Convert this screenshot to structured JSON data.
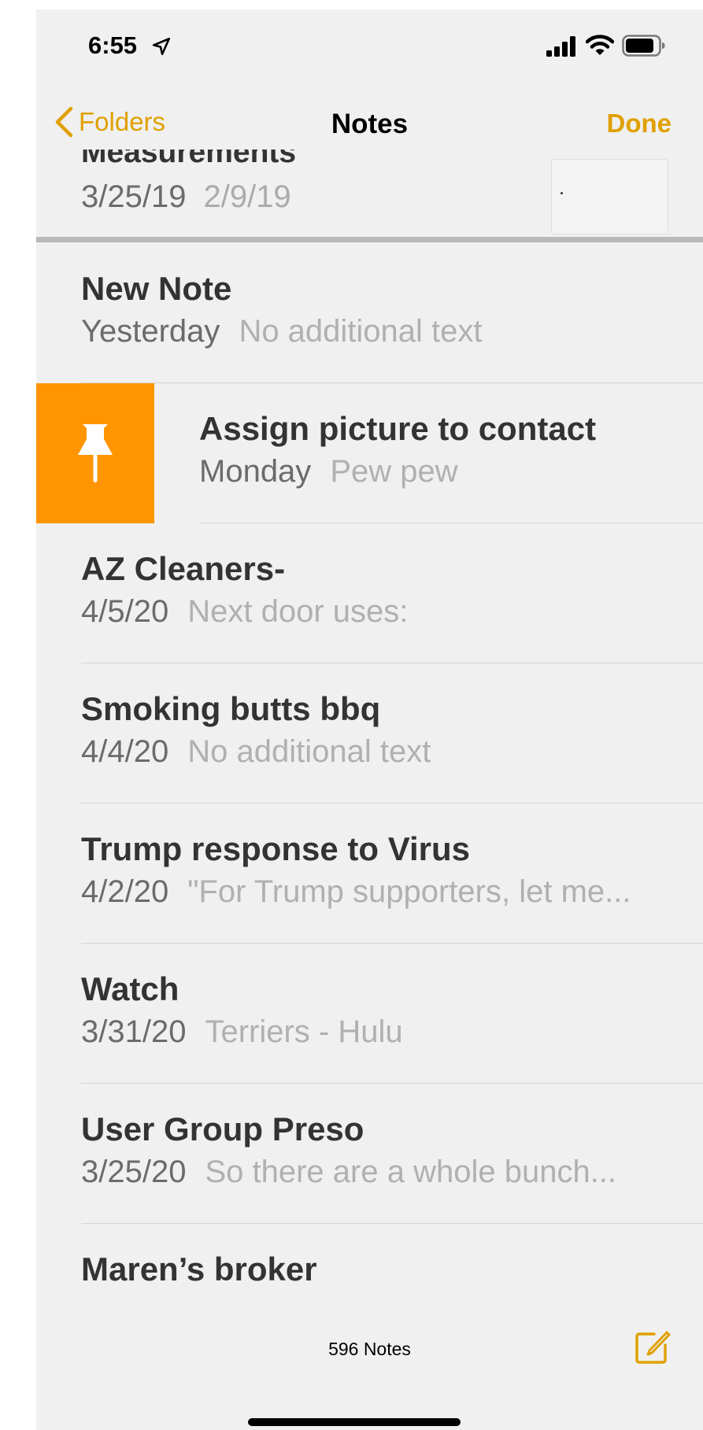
{
  "status_bar": {
    "time": "6:55"
  },
  "nav": {
    "back_label": "Folders",
    "title": "Notes",
    "done_label": "Done"
  },
  "partial_note": {
    "title": "Measurements",
    "date": "3/25/19",
    "preview": "2/9/19"
  },
  "notes": [
    {
      "title": "New Note",
      "date": "Yesterday",
      "preview": "No additional text",
      "pinned_swipe": false
    },
    {
      "title": "Assign picture to contact",
      "date": "Monday",
      "preview": "Pew pew",
      "pinned_swipe": true
    },
    {
      "title": "AZ Cleaners-",
      "date": "4/5/20",
      "preview": "Next door uses:",
      "pinned_swipe": false
    },
    {
      "title": "Smoking butts bbq",
      "date": "4/4/20",
      "preview": "No additional text",
      "pinned_swipe": false
    },
    {
      "title": "Trump response to Virus",
      "date": "4/2/20",
      "preview": "\"For Trump supporters, let me...",
      "pinned_swipe": false
    },
    {
      "title": "Watch",
      "date": "3/31/20",
      "preview": "Terriers - Hulu",
      "pinned_swipe": false
    },
    {
      "title": "User Group Preso",
      "date": "3/25/20",
      "preview": "So there are a whole bunch...",
      "pinned_swipe": false
    },
    {
      "title": "Maren’s broker",
      "date": "",
      "preview": "",
      "pinned_swipe": false
    }
  ],
  "toolbar": {
    "count_label": "596 Notes"
  },
  "colors": {
    "accent": "#e0a000",
    "pin_action": "#ff9500",
    "background": "#f0f0f0"
  },
  "icons": {
    "back": "chevron-left-icon",
    "pin": "pin-icon",
    "compose": "compose-icon",
    "location": "location-arrow-icon",
    "signal": "cellular-signal-icon",
    "wifi": "wifi-icon",
    "battery": "battery-icon"
  }
}
